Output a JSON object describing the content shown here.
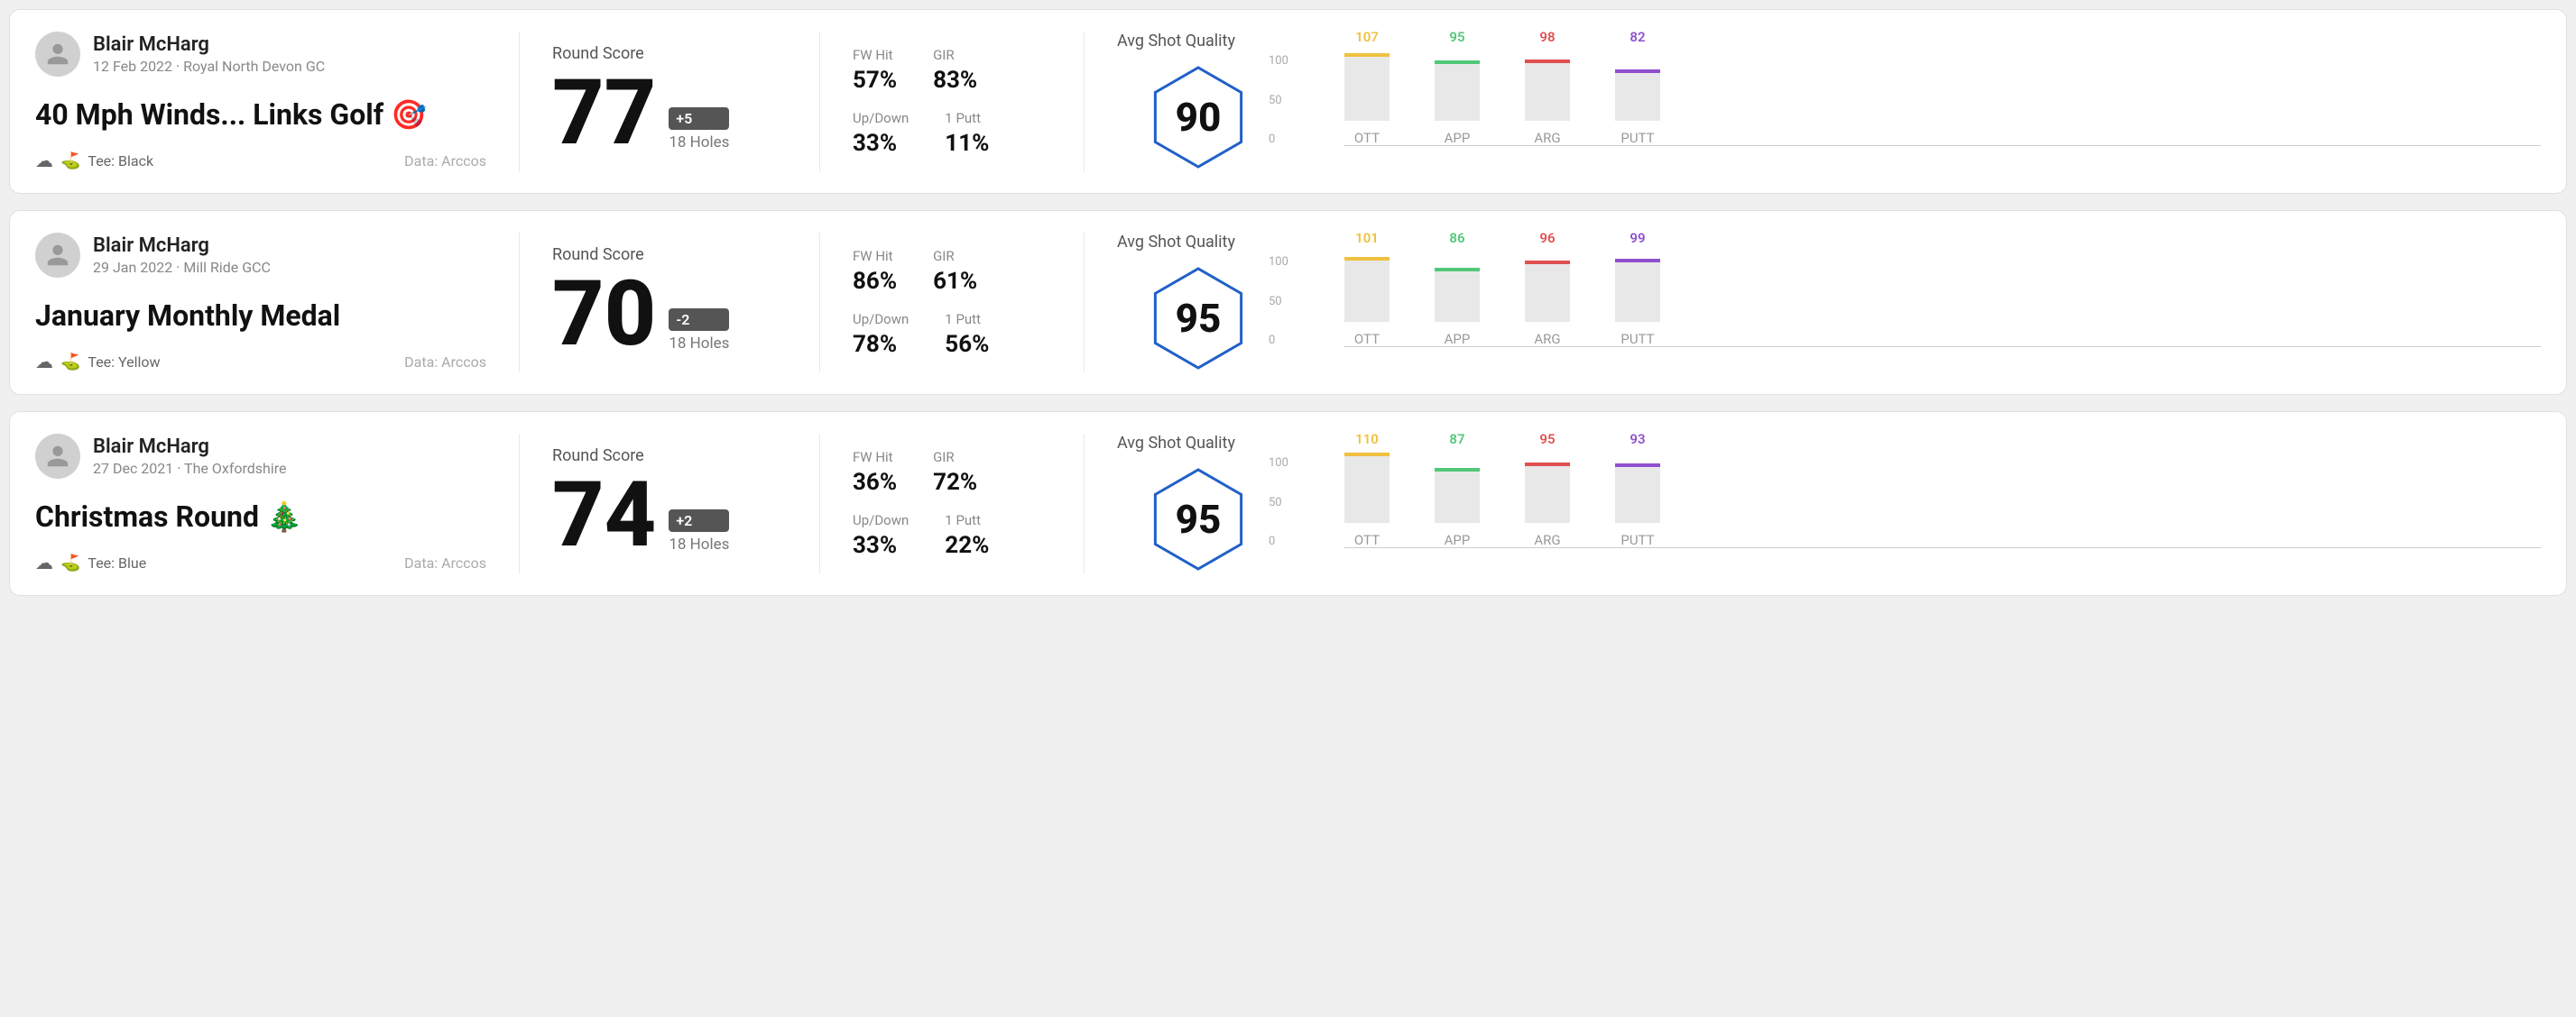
{
  "rounds": [
    {
      "id": "round1",
      "player_name": "Blair McHarg",
      "date": "12 Feb 2022 · Royal North Devon GC",
      "title": "40 Mph Winds... Links Golf",
      "title_emoji": "🎯",
      "tee": "Tee: Black",
      "data_source": "Data: Arccos",
      "score": "77",
      "score_diff": "+5",
      "holes": "18 Holes",
      "fw_hit_label": "FW Hit",
      "fw_hit_value": "57%",
      "gir_label": "GIR",
      "gir_value": "83%",
      "updown_label": "Up/Down",
      "updown_value": "33%",
      "oneputt_label": "1 Putt",
      "oneputt_value": "11%",
      "avg_shot_label": "Avg Shot Quality",
      "hex_score": "90",
      "bars": [
        {
          "label": "OTT",
          "value": 107,
          "color": "#f0c040",
          "pct": 75
        },
        {
          "label": "APP",
          "value": 95,
          "color": "#50c878",
          "pct": 67
        },
        {
          "label": "ARG",
          "value": 98,
          "color": "#e05050",
          "pct": 68
        },
        {
          "label": "PUTT",
          "value": 82,
          "color": "#9050d0",
          "pct": 57
        }
      ],
      "y_labels": [
        "100",
        "50",
        "0"
      ]
    },
    {
      "id": "round2",
      "player_name": "Blair McHarg",
      "date": "29 Jan 2022 · Mill Ride GCC",
      "title": "January Monthly Medal",
      "title_emoji": "",
      "tee": "Tee: Yellow",
      "data_source": "Data: Arccos",
      "score": "70",
      "score_diff": "-2",
      "holes": "18 Holes",
      "fw_hit_label": "FW Hit",
      "fw_hit_value": "86%",
      "gir_label": "GIR",
      "gir_value": "61%",
      "updown_label": "Up/Down",
      "updown_value": "78%",
      "oneputt_label": "1 Putt",
      "oneputt_value": "56%",
      "avg_shot_label": "Avg Shot Quality",
      "hex_score": "95",
      "bars": [
        {
          "label": "OTT",
          "value": 101,
          "color": "#f0c040",
          "pct": 72
        },
        {
          "label": "APP",
          "value": 86,
          "color": "#50c878",
          "pct": 60
        },
        {
          "label": "ARG",
          "value": 96,
          "color": "#e05050",
          "pct": 68
        },
        {
          "label": "PUTT",
          "value": 99,
          "color": "#9050d0",
          "pct": 70
        }
      ],
      "y_labels": [
        "100",
        "50",
        "0"
      ]
    },
    {
      "id": "round3",
      "player_name": "Blair McHarg",
      "date": "27 Dec 2021 · The Oxfordshire",
      "title": "Christmas Round",
      "title_emoji": "🎄",
      "tee": "Tee: Blue",
      "data_source": "Data: Arccos",
      "score": "74",
      "score_diff": "+2",
      "holes": "18 Holes",
      "fw_hit_label": "FW Hit",
      "fw_hit_value": "36%",
      "gir_label": "GIR",
      "gir_value": "72%",
      "updown_label": "Up/Down",
      "updown_value": "33%",
      "oneputt_label": "1 Putt",
      "oneputt_value": "22%",
      "avg_shot_label": "Avg Shot Quality",
      "hex_score": "95",
      "bars": [
        {
          "label": "OTT",
          "value": 110,
          "color": "#f0c040",
          "pct": 78
        },
        {
          "label": "APP",
          "value": 87,
          "color": "#50c878",
          "pct": 61
        },
        {
          "label": "ARG",
          "value": 95,
          "color": "#e05050",
          "pct": 67
        },
        {
          "label": "PUTT",
          "value": 93,
          "color": "#9050d0",
          "pct": 66
        }
      ],
      "y_labels": [
        "100",
        "50",
        "0"
      ]
    }
  ]
}
